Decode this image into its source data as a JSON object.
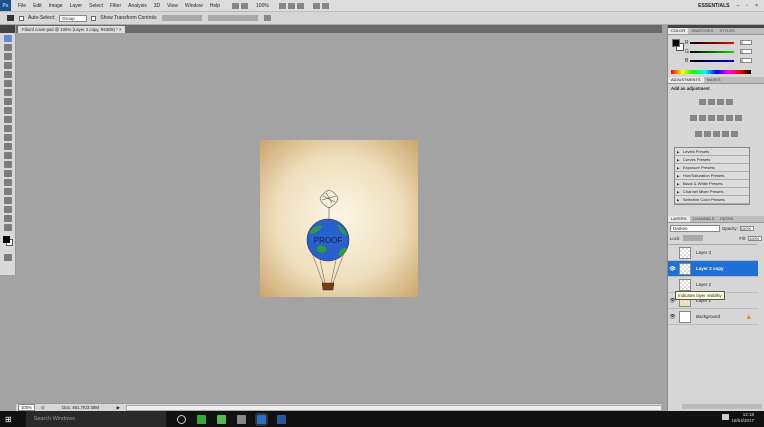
{
  "app": {
    "logo": "Ps",
    "menu": [
      "File",
      "Edit",
      "Image",
      "Layer",
      "Select",
      "Filter",
      "Analysis",
      "3D",
      "View",
      "Window",
      "Help"
    ],
    "zoom": "100%",
    "workspace": "ESSENTIALS"
  },
  "options": {
    "auto_select_label": "Auto-Select:",
    "auto_select_value": "Group",
    "show_transform_label": "Show Transform Controls"
  },
  "document": {
    "tab_title": "Fibonf cover.psd @ 100% (Layer 2 copy, RGB/8) *",
    "artwork_text": "PROOF"
  },
  "status": {
    "zoom": "100%",
    "doc_info": "Doc: 461.7K/3.08M"
  },
  "color_panel": {
    "tabs": [
      "COLOR",
      "SWATCHES",
      "STYLES"
    ],
    "channels": [
      {
        "label": "R",
        "value": "0",
        "color": "#d00000"
      },
      {
        "label": "G",
        "value": "0",
        "color": "#00b000"
      },
      {
        "label": "B",
        "value": "0",
        "color": "#0000c0"
      }
    ]
  },
  "adjustments_panel": {
    "tabs": [
      "ADJUSTMENTS",
      "MASKS"
    ],
    "heading": "Add an adjustment",
    "presets": [
      "Levels Presets",
      "Curves Presets",
      "Exposure Presets",
      "Hue/Saturation Presets",
      "Black & White Presets",
      "Channel Mixer Presets",
      "Selective Color Presets"
    ]
  },
  "layers_panel": {
    "tabs": [
      "LAYERS",
      "CHANNELS",
      "PATHS"
    ],
    "blend_mode": "Darken",
    "opacity_label": "Opacity:",
    "opacity": "100%",
    "lock_label": "Lock:",
    "fill_label": "Fill:",
    "fill": "100%",
    "layers": [
      {
        "name": "Layer 3",
        "visible": false,
        "selected": false
      },
      {
        "name": "Layer 2 copy",
        "visible": true,
        "selected": true
      },
      {
        "name": "Layer 2",
        "visible": false,
        "selected": false
      },
      {
        "name": "Layer 1",
        "visible": true,
        "selected": false
      },
      {
        "name": "Background",
        "visible": true,
        "selected": false,
        "locked": true
      }
    ],
    "tooltip": "Indicates layer visibility"
  },
  "taskbar": {
    "search_placeholder": "Search Windows",
    "time": "12:18",
    "date": "18/04/2017"
  },
  "colors": {
    "accent": "#1f6fd6",
    "globe": "#2a5fd0",
    "land": "#2e9e3a"
  }
}
